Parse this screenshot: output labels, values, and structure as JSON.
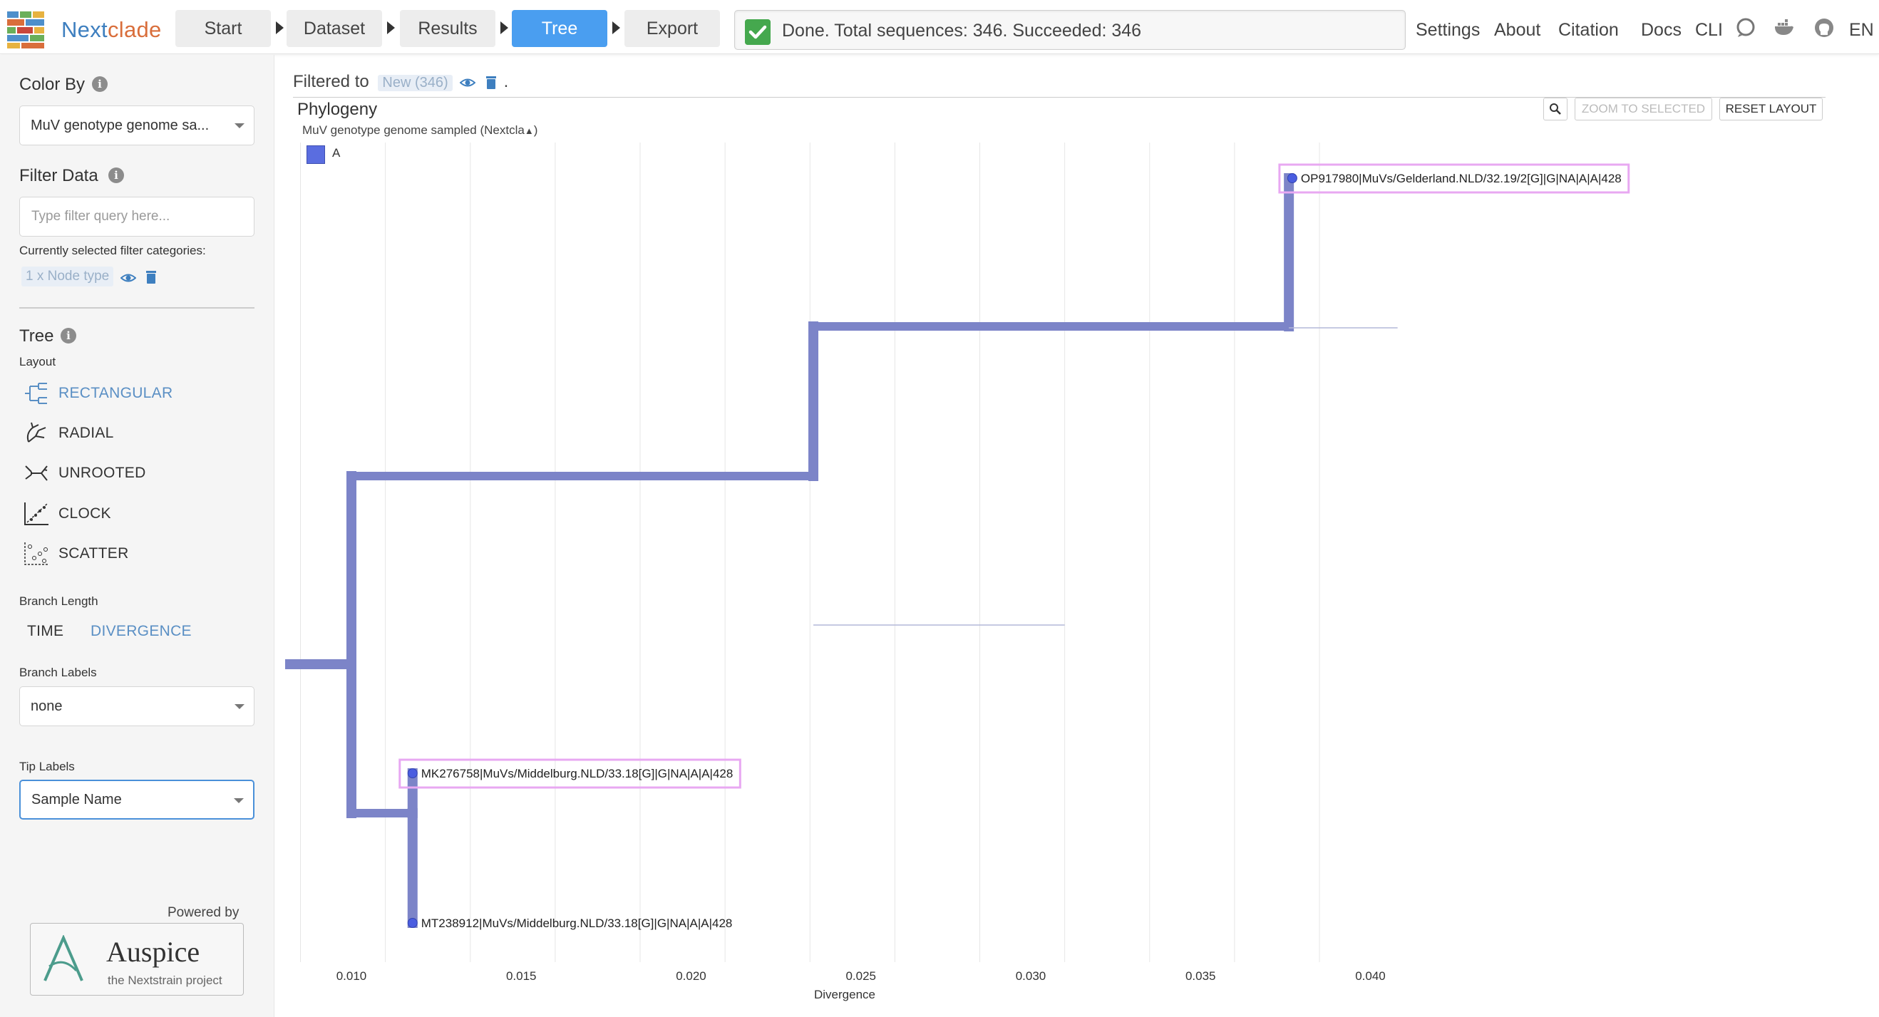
{
  "nav": {
    "brand": "Nextclade",
    "steps": [
      {
        "label": "Start"
      },
      {
        "label": "Dataset"
      },
      {
        "label": "Results"
      },
      {
        "label": "Tree"
      },
      {
        "label": "Export"
      }
    ],
    "active_step": "Tree",
    "status": "Done. Total sequences: 346. Succeeded: 346",
    "links": [
      "Settings",
      "About",
      "Citation",
      "Docs",
      "CLI"
    ],
    "icons": [
      "discussion-icon",
      "docker-icon",
      "github-icon"
    ],
    "language": "EN"
  },
  "sidebar": {
    "color_by": {
      "title": "Color By",
      "selected": "MuV genotype genome sa..."
    },
    "filter": {
      "title": "Filter Data",
      "placeholder": "Type filter query here...",
      "selected_label": "Currently selected filter categories:",
      "chip": "1 x Node type"
    },
    "tree": {
      "title": "Tree",
      "layout_label": "Layout",
      "layouts": [
        "RECTANGULAR",
        "RADIAL",
        "UNROOTED",
        "CLOCK",
        "SCATTER"
      ],
      "selected_layout": "RECTANGULAR",
      "branch_length_label": "Branch Length",
      "branch_length_options": [
        "TIME",
        "DIVERGENCE"
      ],
      "selected_branch_length": "DIVERGENCE",
      "branch_labels_label": "Branch Labels",
      "branch_labels_value": "none",
      "tip_labels_label": "Tip Labels",
      "tip_labels_value": "Sample Name"
    },
    "powered_by": "Powered by",
    "auspice": {
      "name": "Auspice",
      "subtitle": "the Nextstrain project"
    }
  },
  "main": {
    "filtered_prefix": "Filtered to",
    "filtered_chip": "New (346)",
    "filtered_suffix": ".",
    "panel_title": "Phylogeny",
    "legend_title": "MuV genotype genome sampled (Nextcla",
    "legend_items": [
      {
        "label": "A",
        "color": "#5a6de0"
      }
    ],
    "buttons": {
      "zoom_selected": "ZOOM TO SELECTED",
      "reset_layout": "RESET LAYOUT"
    }
  },
  "chart_data": {
    "type": "tree",
    "xlabel": "Divergence",
    "xlim": [
      0.0055,
      0.0485
    ],
    "x_ticks": [
      0.01,
      0.015,
      0.02,
      0.025,
      0.03,
      0.035,
      0.04
    ],
    "x_tick_labels": [
      "0.010",
      "0.015",
      "0.020",
      "0.025",
      "0.030",
      "0.035",
      "0.040"
    ],
    "grid": true,
    "branch_color": "#7c84c8",
    "tip_color": "#4a5de0",
    "nodes": [
      {
        "id": "root",
        "parent": null,
        "div": 0.0085
      },
      {
        "id": "n1",
        "parent": "root",
        "div": 0.01
      },
      {
        "id": "n2",
        "parent": "n1",
        "div": 0.0236
      },
      {
        "id": "n3",
        "parent": "n2",
        "div": 0.0376
      },
      {
        "id": "n4",
        "parent": "n1",
        "div": 0.0118
      },
      {
        "id": "OP917980",
        "parent": "n3",
        "div": 0.0377,
        "label": "OP917980|MuVs/Gelderland.NLD/32.19/2[G]|G|NA|A|A|428",
        "highlighted": true
      },
      {
        "id": "n3-hidden",
        "parent": "n3",
        "div": 0.0408,
        "hidden": true
      },
      {
        "id": "n2-hidden",
        "parent": "n2",
        "div": 0.031,
        "hidden": true
      },
      {
        "id": "MK276758",
        "parent": "n4",
        "div": 0.0118,
        "label": "MK276758|MuVs/Middelburg.NLD/33.18[G]|G|NA|A|A|428",
        "highlighted": true
      },
      {
        "id": "MT238912",
        "parent": "n4",
        "div": 0.0118,
        "label": "MT238912|MuVs/Middelburg.NLD/33.18[G]|G|NA|A|A|428",
        "highlighted": false
      }
    ]
  }
}
